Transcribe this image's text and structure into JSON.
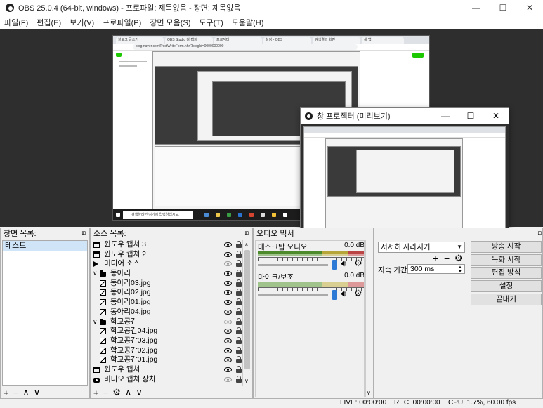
{
  "window": {
    "title": "OBS 25.0.4 (64-bit, windows) - 프로파일: 제목없음 - 장면: 제목없음",
    "minimize": "—",
    "maximize": "☐",
    "close": "✕"
  },
  "menu": [
    "파일(F)",
    "편집(E)",
    "보기(V)",
    "프로파일(P)",
    "장면 모음(S)",
    "도구(T)",
    "도움말(H)"
  ],
  "preview": {
    "browser_tabs": [
      "블로그 글쓰기",
      "OBS Studio 창 캡처",
      "프로젝터",
      "설정 - OBS",
      "검색결과 화면",
      "새 탭"
    ],
    "url": "blog.naver.com/PostWriteForm.nhn?blogId=0000000000",
    "taskbar_search": "검색하려면 여기에 입력하십시오."
  },
  "projector": {
    "title": "창 프로젝터 (미리보기)",
    "minimize": "—",
    "maximize": "☐",
    "close": "✕"
  },
  "scenes": {
    "title": "장면 목록:",
    "items": [
      "테스트"
    ],
    "toolbar": [
      "+",
      "−",
      "∧",
      "∨"
    ]
  },
  "sources": {
    "title": "소스 목록:",
    "items": [
      {
        "label": "윈도우 캡쳐 3",
        "icon": "window-icon",
        "indent": 0,
        "visible": true,
        "locked": true
      },
      {
        "label": "윈도우 캡쳐 2",
        "icon": "window-icon",
        "indent": 0,
        "visible": true,
        "locked": true
      },
      {
        "label": "미디어 소스",
        "icon": "media-icon",
        "indent": 0,
        "visible": false,
        "locked": true
      },
      {
        "label": "동아리",
        "icon": "folder-icon",
        "indent": 0,
        "visible": true,
        "locked": true,
        "expand": "∨"
      },
      {
        "label": "동아리03.jpg",
        "icon": "image-icon",
        "indent": 1,
        "visible": true,
        "locked": true
      },
      {
        "label": "동아리02.jpg",
        "icon": "image-icon",
        "indent": 1,
        "visible": true,
        "locked": true
      },
      {
        "label": "동아리01.jpg",
        "icon": "image-icon",
        "indent": 1,
        "visible": true,
        "locked": true
      },
      {
        "label": "동아리04.jpg",
        "icon": "image-icon",
        "indent": 1,
        "visible": true,
        "locked": true
      },
      {
        "label": "학교공간",
        "icon": "folder-icon",
        "indent": 0,
        "visible": false,
        "locked": true,
        "expand": "∨"
      },
      {
        "label": "학교공간04.jpg",
        "icon": "image-icon",
        "indent": 1,
        "visible": true,
        "locked": true
      },
      {
        "label": "학교공간03.jpg",
        "icon": "image-icon",
        "indent": 1,
        "visible": true,
        "locked": true
      },
      {
        "label": "학교공간02.jpg",
        "icon": "image-icon",
        "indent": 1,
        "visible": true,
        "locked": true
      },
      {
        "label": "학교공간01.jpg",
        "icon": "image-icon",
        "indent": 1,
        "visible": true,
        "locked": true
      },
      {
        "label": "윈도우 캡쳐",
        "icon": "window-icon",
        "indent": 0,
        "visible": true,
        "locked": true
      },
      {
        "label": "비디오 캡쳐 장치",
        "icon": "camera-icon",
        "indent": 0,
        "visible": false,
        "locked": true
      }
    ],
    "toolbar": [
      "+",
      "−",
      "⚙",
      "∧",
      "∨"
    ]
  },
  "mixer": {
    "title": "오디오 믹서",
    "channels": [
      {
        "name": "데스크탑 오디오",
        "db": "0.0 dB",
        "level": 0.65
      },
      {
        "name": "마이크/보조",
        "db": "0.0 dB",
        "level": 0.65
      }
    ],
    "ticks": [
      "-60",
      "-55",
      "-50",
      "-45",
      "-40",
      "-35",
      "-30",
      "-25",
      "-20",
      "-15",
      "-10",
      "-5",
      "0"
    ]
  },
  "transitions": {
    "selected": "서서히 사라지기",
    "duration_label": "지속 기간",
    "duration_value": "300 ms",
    "add": "+",
    "remove": "−",
    "settings": "⚙"
  },
  "controls": {
    "buttons": [
      "방송 시작",
      "녹화 시작",
      "편집 방식",
      "설정",
      "끝내기"
    ]
  },
  "status": {
    "live": "LIVE: 00:00:00",
    "rec": "REC: 00:00:00",
    "cpu": "CPU: 1.7%, 60.00 fps"
  },
  "colors": {
    "accent": "#2c7ad6",
    "selection": "#cfe4f7",
    "preview_bg": "#2e2e2e",
    "naver_green": "#1ec800"
  }
}
